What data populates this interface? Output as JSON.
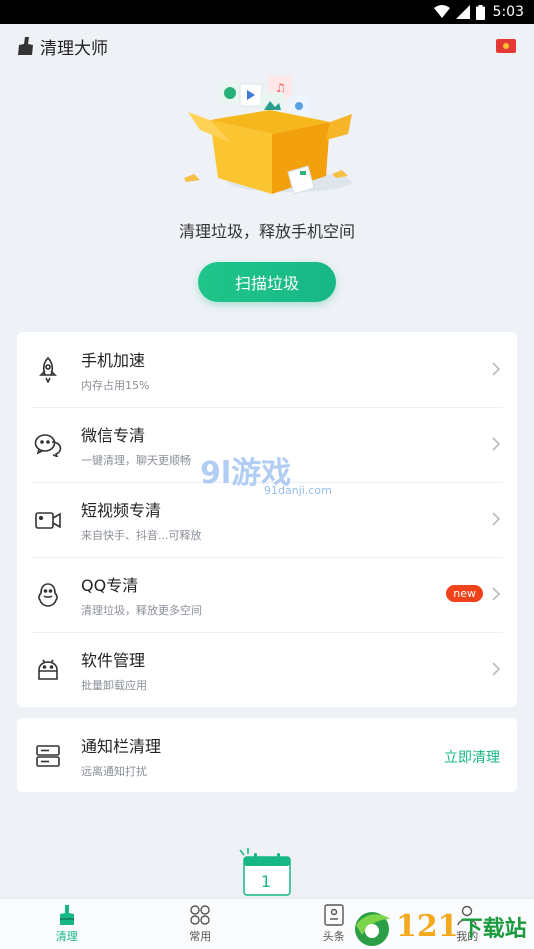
{
  "status_bar": {
    "time": "5:03"
  },
  "header": {
    "app_name": "清理大师"
  },
  "hero": {
    "caption": "清理垃圾，释放手机空间",
    "scan_button": "扫描垃圾"
  },
  "features": [
    {
      "icon": "rocket-icon",
      "title": "手机加速",
      "subtitle": "内存占用15%"
    },
    {
      "icon": "wechat-icon",
      "title": "微信专清",
      "subtitle": "一键清理，聊天更顺畅"
    },
    {
      "icon": "video-camera-icon",
      "title": "短视频专清",
      "subtitle": "来自快手、抖音...可释放"
    },
    {
      "icon": "qq-penguin-icon",
      "title": "QQ专清",
      "subtitle": "清理垃圾，释放更多空间",
      "badge": "new"
    },
    {
      "icon": "android-icon",
      "title": "软件管理",
      "subtitle": "批量卸载应用"
    }
  ],
  "notification_card": {
    "icon": "notification-bar-icon",
    "title": "通知栏清理",
    "subtitle": "远离通知打扰",
    "action": "立即清理"
  },
  "calendar_widget": {
    "day": "1"
  },
  "tabs": [
    {
      "label": "清理",
      "icon": "broom-icon",
      "active": true
    },
    {
      "label": "常用",
      "icon": "grid-icon",
      "active": false
    },
    {
      "label": "头条",
      "icon": "news-icon",
      "active": false
    },
    {
      "label": "我的",
      "icon": "profile-icon",
      "active": false
    }
  ],
  "watermarks": {
    "center_logo": "9l游戏",
    "center_domain": "91danji.com",
    "corner_number": "121",
    "corner_text": "下载站"
  },
  "colors": {
    "accent": "#17b786",
    "badge": "#f0421b",
    "background": "#eef1f6"
  }
}
